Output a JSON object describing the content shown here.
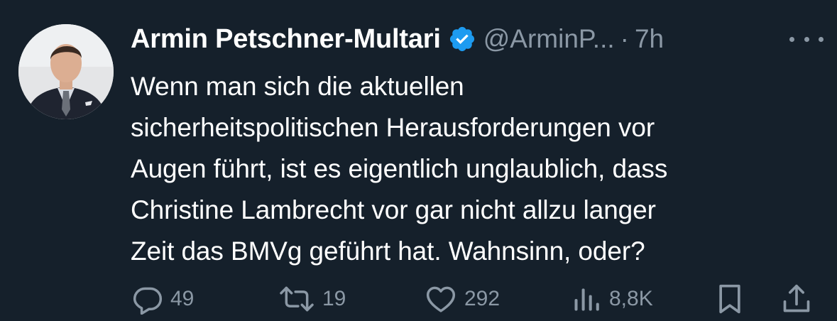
{
  "author": {
    "display_name": "Armin Petschner-Multari",
    "handle": "@ArminP...",
    "verified": true,
    "verified_color": "#1d9bf0"
  },
  "time_separator": "·",
  "time": "7h",
  "tweet_lines": [
    "Wenn man sich die aktuellen",
    "sicherheitspolitischen Herausforderungen vor",
    "Augen führt, ist es eigentlich unglaublich, dass",
    "Christine Lambrecht vor gar nicht allzu langer",
    "Zeit das BMVg geführt hat. Wahnsinn, oder?"
  ],
  "actions": {
    "reply": {
      "icon": "reply-icon",
      "count": "49"
    },
    "retweet": {
      "icon": "retweet-icon",
      "count": "19"
    },
    "like": {
      "icon": "heart-icon",
      "count": "292"
    },
    "views": {
      "icon": "analytics-icon",
      "count": "8,8K"
    },
    "bookmark": {
      "icon": "bookmark-icon"
    },
    "share": {
      "icon": "share-icon"
    }
  },
  "colors": {
    "background": "#15202b",
    "text": "#ffffff",
    "secondary_text": "#8b98a5",
    "verified": "#1d9bf0"
  }
}
